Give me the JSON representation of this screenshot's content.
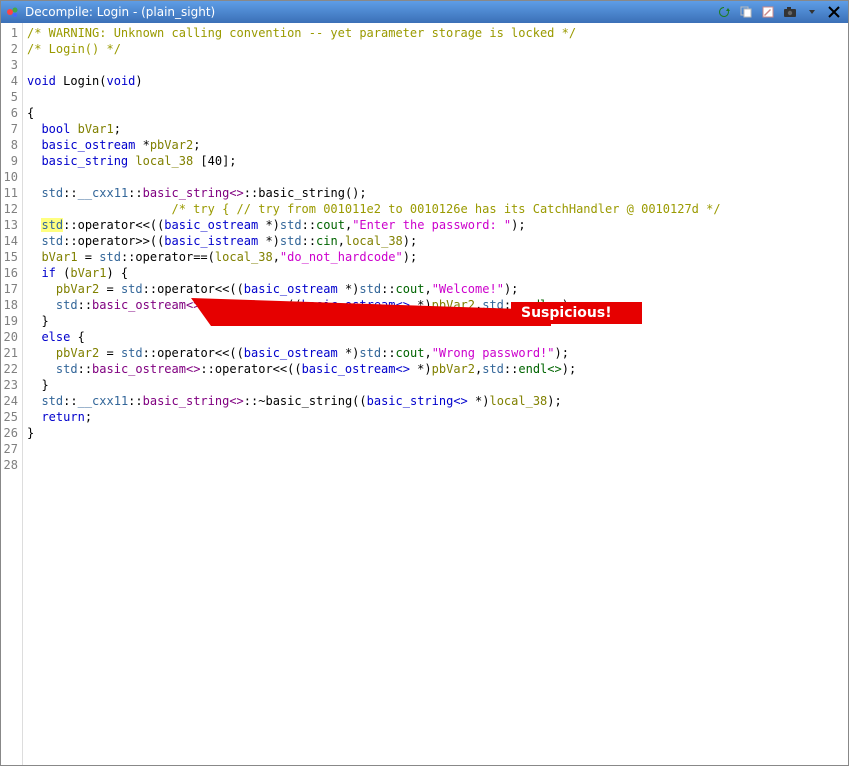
{
  "titlebar": {
    "title": "Decompile: Login - (plain_sight)"
  },
  "annotation": {
    "label": "Suspicious!"
  },
  "code": {
    "lines": [
      [
        {
          "cls": "c-comment",
          "t": "/* WARNING: Unknown calling convention -- yet parameter storage is locked */"
        }
      ],
      [
        {
          "cls": "c-comment",
          "t": "/* Login() */"
        }
      ],
      [],
      [
        {
          "cls": "c-keyword",
          "t": "void"
        },
        {
          "cls": "",
          "t": " "
        },
        {
          "cls": "c-name",
          "t": "Login"
        },
        {
          "cls": "",
          "t": "("
        },
        {
          "cls": "c-keyword",
          "t": "void"
        },
        {
          "cls": "",
          "t": ")"
        }
      ],
      [],
      [
        {
          "cls": "",
          "t": "{"
        }
      ],
      [
        {
          "cls": "",
          "t": "  "
        },
        {
          "cls": "c-type",
          "t": "bool"
        },
        {
          "cls": "",
          "t": " "
        },
        {
          "cls": "c-var",
          "t": "bVar1"
        },
        {
          "cls": "",
          "t": ";"
        }
      ],
      [
        {
          "cls": "",
          "t": "  "
        },
        {
          "cls": "c-type",
          "t": "basic_ostream"
        },
        {
          "cls": "",
          "t": " *"
        },
        {
          "cls": "c-var",
          "t": "pbVar2"
        },
        {
          "cls": "",
          "t": ";"
        }
      ],
      [
        {
          "cls": "",
          "t": "  "
        },
        {
          "cls": "c-type",
          "t": "basic_string"
        },
        {
          "cls": "",
          "t": " "
        },
        {
          "cls": "c-var",
          "t": "local_38"
        },
        {
          "cls": "",
          "t": " [40];"
        }
      ],
      [],
      [
        {
          "cls": "",
          "t": "  "
        },
        {
          "cls": "c-ns",
          "t": "std"
        },
        {
          "cls": "",
          "t": "::"
        },
        {
          "cls": "c-ns",
          "t": "__cxx11"
        },
        {
          "cls": "",
          "t": "::"
        },
        {
          "cls": "c-member",
          "t": "basic_string<>"
        },
        {
          "cls": "",
          "t": "::"
        },
        {
          "cls": "c-func",
          "t": "basic_string"
        },
        {
          "cls": "",
          "t": "();"
        }
      ],
      [
        {
          "cls": "c-comment",
          "t": "                    /* try { // try from 001011e2 to 0010126e has its CatchHandler @ 0010127d */"
        }
      ],
      [
        {
          "cls": "",
          "t": "  "
        },
        {
          "cls": "c-ns c-hl",
          "t": "std"
        },
        {
          "cls": "",
          "t": "::"
        },
        {
          "cls": "c-func",
          "t": "operator<<"
        },
        {
          "cls": "",
          "t": "(("
        },
        {
          "cls": "c-type",
          "t": "basic_ostream"
        },
        {
          "cls": "",
          "t": " *)"
        },
        {
          "cls": "c-ns",
          "t": "std"
        },
        {
          "cls": "",
          "t": "::"
        },
        {
          "cls": "c-const",
          "t": "cout"
        },
        {
          "cls": "",
          "t": ","
        },
        {
          "cls": "c-string",
          "t": "\"Enter the password: \""
        },
        {
          "cls": "",
          "t": ");"
        }
      ],
      [
        {
          "cls": "",
          "t": "  "
        },
        {
          "cls": "c-ns",
          "t": "std"
        },
        {
          "cls": "",
          "t": "::"
        },
        {
          "cls": "c-func",
          "t": "operator>>"
        },
        {
          "cls": "",
          "t": "(("
        },
        {
          "cls": "c-type",
          "t": "basic_istream"
        },
        {
          "cls": "",
          "t": " *)"
        },
        {
          "cls": "c-ns",
          "t": "std"
        },
        {
          "cls": "",
          "t": "::"
        },
        {
          "cls": "c-const",
          "t": "cin"
        },
        {
          "cls": "",
          "t": ","
        },
        {
          "cls": "c-var",
          "t": "local_38"
        },
        {
          "cls": "",
          "t": ");"
        }
      ],
      [
        {
          "cls": "",
          "t": "  "
        },
        {
          "cls": "c-var",
          "t": "bVar1"
        },
        {
          "cls": "",
          "t": " = "
        },
        {
          "cls": "c-ns",
          "t": "std"
        },
        {
          "cls": "",
          "t": "::"
        },
        {
          "cls": "c-func",
          "t": "operator=="
        },
        {
          "cls": "",
          "t": "("
        },
        {
          "cls": "c-var",
          "t": "local_38"
        },
        {
          "cls": "",
          "t": ","
        },
        {
          "cls": "c-string",
          "t": "\"do_not_hardcode\""
        },
        {
          "cls": "",
          "t": ");"
        }
      ],
      [
        {
          "cls": "",
          "t": "  "
        },
        {
          "cls": "c-keyword",
          "t": "if"
        },
        {
          "cls": "",
          "t": " ("
        },
        {
          "cls": "c-var",
          "t": "bVar1"
        },
        {
          "cls": "",
          "t": ") {"
        }
      ],
      [
        {
          "cls": "",
          "t": "    "
        },
        {
          "cls": "c-var",
          "t": "pbVar2"
        },
        {
          "cls": "",
          "t": " = "
        },
        {
          "cls": "c-ns",
          "t": "std"
        },
        {
          "cls": "",
          "t": "::"
        },
        {
          "cls": "c-func",
          "t": "operator<<"
        },
        {
          "cls": "",
          "t": "(("
        },
        {
          "cls": "c-type",
          "t": "basic_ostream"
        },
        {
          "cls": "",
          "t": " *)"
        },
        {
          "cls": "c-ns",
          "t": "std"
        },
        {
          "cls": "",
          "t": "::"
        },
        {
          "cls": "c-const",
          "t": "cout"
        },
        {
          "cls": "",
          "t": ","
        },
        {
          "cls": "c-string",
          "t": "\"Welcome!\""
        },
        {
          "cls": "",
          "t": ");"
        }
      ],
      [
        {
          "cls": "",
          "t": "    "
        },
        {
          "cls": "c-ns",
          "t": "std"
        },
        {
          "cls": "",
          "t": "::"
        },
        {
          "cls": "c-member",
          "t": "basic_ostream<>"
        },
        {
          "cls": "",
          "t": "::"
        },
        {
          "cls": "c-func",
          "t": "operator<<"
        },
        {
          "cls": "",
          "t": "(("
        },
        {
          "cls": "c-type",
          "t": "basic_ostream<>"
        },
        {
          "cls": "",
          "t": " *)"
        },
        {
          "cls": "c-var",
          "t": "pbVar2"
        },
        {
          "cls": "",
          "t": ","
        },
        {
          "cls": "c-ns",
          "t": "std"
        },
        {
          "cls": "",
          "t": "::"
        },
        {
          "cls": "c-const",
          "t": "endl<>"
        },
        {
          "cls": "",
          "t": ");"
        }
      ],
      [
        {
          "cls": "",
          "t": "  }"
        }
      ],
      [
        {
          "cls": "",
          "t": "  "
        },
        {
          "cls": "c-keyword",
          "t": "else"
        },
        {
          "cls": "",
          "t": " {"
        }
      ],
      [
        {
          "cls": "",
          "t": "    "
        },
        {
          "cls": "c-var",
          "t": "pbVar2"
        },
        {
          "cls": "",
          "t": " = "
        },
        {
          "cls": "c-ns",
          "t": "std"
        },
        {
          "cls": "",
          "t": "::"
        },
        {
          "cls": "c-func",
          "t": "operator<<"
        },
        {
          "cls": "",
          "t": "(("
        },
        {
          "cls": "c-type",
          "t": "basic_ostream"
        },
        {
          "cls": "",
          "t": " *)"
        },
        {
          "cls": "c-ns",
          "t": "std"
        },
        {
          "cls": "",
          "t": "::"
        },
        {
          "cls": "c-const",
          "t": "cout"
        },
        {
          "cls": "",
          "t": ","
        },
        {
          "cls": "c-string",
          "t": "\"Wrong password!\""
        },
        {
          "cls": "",
          "t": ");"
        }
      ],
      [
        {
          "cls": "",
          "t": "    "
        },
        {
          "cls": "c-ns",
          "t": "std"
        },
        {
          "cls": "",
          "t": "::"
        },
        {
          "cls": "c-member",
          "t": "basic_ostream<>"
        },
        {
          "cls": "",
          "t": "::"
        },
        {
          "cls": "c-func",
          "t": "operator<<"
        },
        {
          "cls": "",
          "t": "(("
        },
        {
          "cls": "c-type",
          "t": "basic_ostream<>"
        },
        {
          "cls": "",
          "t": " *)"
        },
        {
          "cls": "c-var",
          "t": "pbVar2"
        },
        {
          "cls": "",
          "t": ","
        },
        {
          "cls": "c-ns",
          "t": "std"
        },
        {
          "cls": "",
          "t": "::"
        },
        {
          "cls": "c-const",
          "t": "endl<>"
        },
        {
          "cls": "",
          "t": ");"
        }
      ],
      [
        {
          "cls": "",
          "t": "  }"
        }
      ],
      [
        {
          "cls": "",
          "t": "  "
        },
        {
          "cls": "c-ns",
          "t": "std"
        },
        {
          "cls": "",
          "t": "::"
        },
        {
          "cls": "c-ns",
          "t": "__cxx11"
        },
        {
          "cls": "",
          "t": "::"
        },
        {
          "cls": "c-member",
          "t": "basic_string<>"
        },
        {
          "cls": "",
          "t": "::~"
        },
        {
          "cls": "c-func",
          "t": "basic_string"
        },
        {
          "cls": "",
          "t": "(("
        },
        {
          "cls": "c-type",
          "t": "basic_string<>"
        },
        {
          "cls": "",
          "t": " *)"
        },
        {
          "cls": "c-var",
          "t": "local_38"
        },
        {
          "cls": "",
          "t": ");"
        }
      ],
      [
        {
          "cls": "",
          "t": "  "
        },
        {
          "cls": "c-keyword",
          "t": "return"
        },
        {
          "cls": "",
          "t": ";"
        }
      ],
      [
        {
          "cls": "",
          "t": "}"
        }
      ],
      []
    ],
    "line_count": 28
  }
}
